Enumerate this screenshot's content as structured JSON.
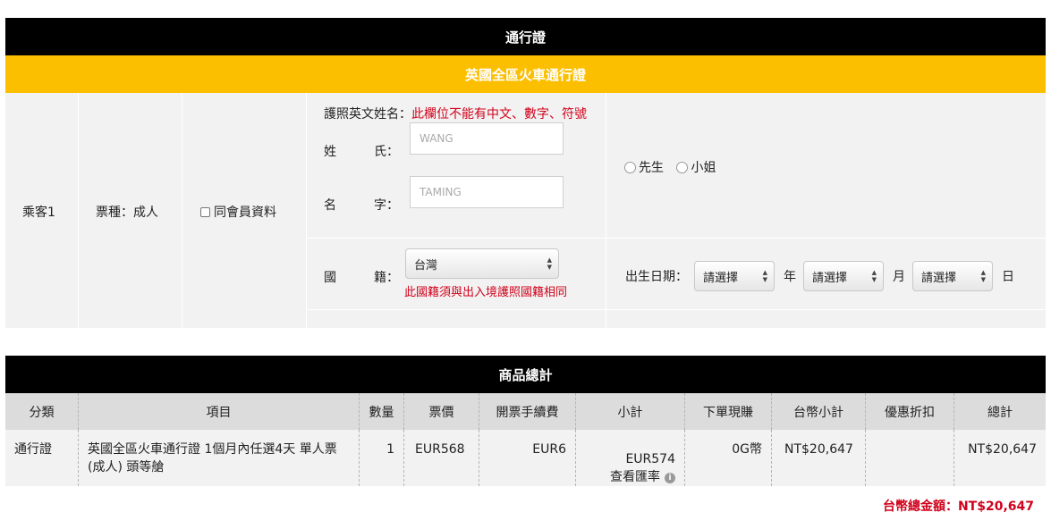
{
  "pass_header": {
    "title": "通行證"
  },
  "product_bar": {
    "title": "英國全區火車通行證"
  },
  "passenger": {
    "label": "乘客1",
    "ticket_type": "票種：成人",
    "same_member_label": "同會員資料",
    "passport_name_label": "護照英文姓名：",
    "passport_name_warning": "此欄位不能有中文、數字、符號",
    "surname_label_1": "姓",
    "surname_label_2": "氏：",
    "surname_placeholder": "WANG",
    "given_label_1": "名",
    "given_label_2": "字：",
    "given_placeholder": "TAMING",
    "title_options": [
      "先生",
      "小姐"
    ],
    "nationality_label_1": "國",
    "nationality_label_2": "籍：",
    "nationality_value": "台灣",
    "nationality_note": "此國籍須與出入境護照國籍相同",
    "birth_label": "出生日期：",
    "year_placeholder": "請選擇",
    "year_unit": "年",
    "month_placeholder": "請選擇",
    "month_unit": "月",
    "day_placeholder": "請選擇",
    "day_unit": "日"
  },
  "summary": {
    "title": "商品總計",
    "columns": [
      "分類",
      "項目",
      "數量",
      "票價",
      "開票手續費",
      "小計",
      "下單現賺",
      "台幣小計",
      "優惠折扣",
      "總計"
    ],
    "row": {
      "category": "通行證",
      "item_line1": "英國全區火車通行證 1個月內任選4天 單人票",
      "item_line2": "(成人) 頭等艙",
      "qty": "1",
      "price": "EUR568",
      "fee": "EUR6",
      "subtotal": "EUR574",
      "rate_link": "查看匯率",
      "earn": "0G幣",
      "twd_subtotal": "NT$20,647",
      "discount": "",
      "total": "NT$20,647"
    },
    "grand_total": "台幣總金額：NT$20,647"
  },
  "colors": {
    "header_bg": "#000000",
    "product_bar_bg": "#fcbf00",
    "warning": "#d0021b",
    "row_bg": "#f2f2f2",
    "table_head_bg": "#dcdcdc"
  }
}
